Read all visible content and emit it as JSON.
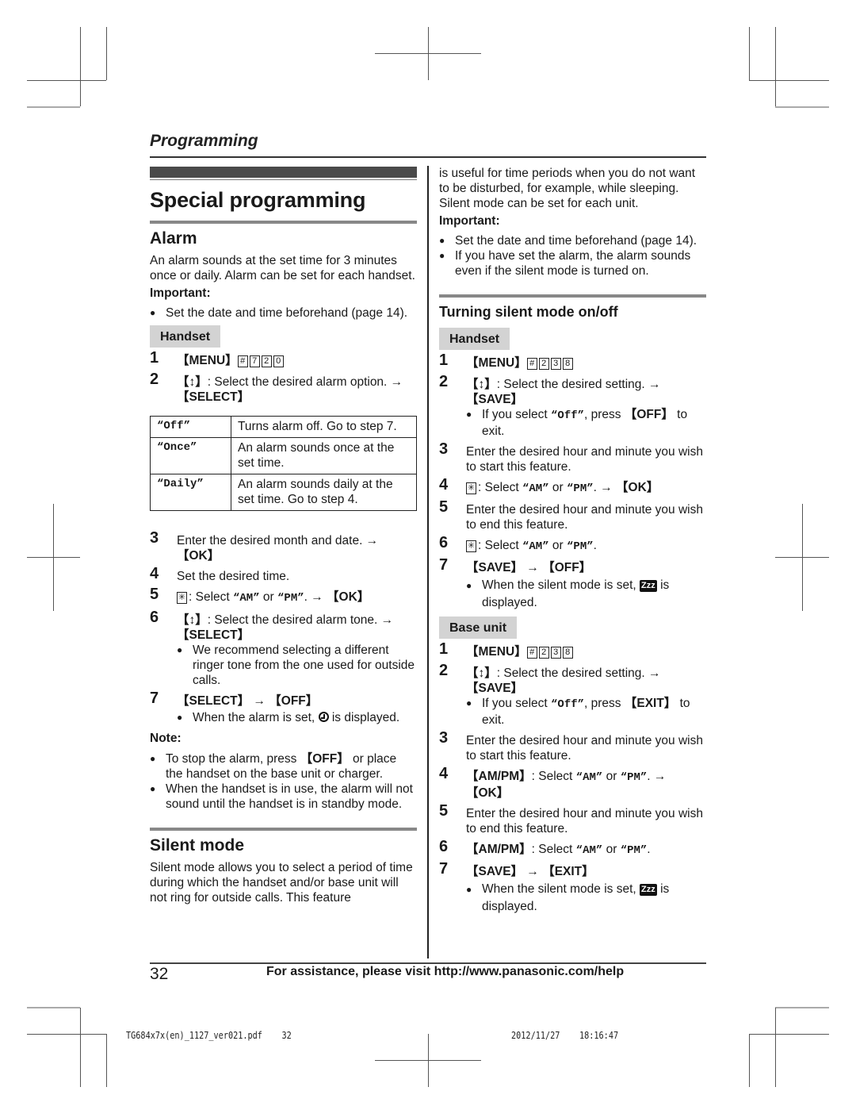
{
  "header": {
    "running_title": "Programming"
  },
  "left_column": {
    "page_title": "Special programming",
    "alarm": {
      "heading": "Alarm",
      "intro": "An alarm sounds at the set time for 3 minutes once or daily. Alarm can be set for each handset.",
      "important_label": "Important:",
      "important_items": [
        "Set the date and time beforehand (page 14)."
      ],
      "unit_tag": "Handset",
      "step1": {
        "num": "1",
        "key": "【MENU】",
        "codes": [
          "#",
          "7",
          "2",
          "0"
        ]
      },
      "step2": {
        "num": "2",
        "nav": "【↕】",
        "text": ": Select the desired alarm option. →",
        "key": "【SELECT】"
      },
      "options_table": [
        {
          "option": "“Off”",
          "desc": "Turns alarm off. Go to step 7."
        },
        {
          "option": "“Once”",
          "desc": "An alarm sounds once at the set time."
        },
        {
          "option": "“Daily”",
          "desc": "An alarm sounds daily at the set time. Go to step 4."
        }
      ],
      "step3": {
        "num": "3",
        "text": "Enter the desired month and date. →",
        "key": "【OK】"
      },
      "step4": {
        "num": "4",
        "text": "Set the desired time."
      },
      "step5": {
        "num": "5",
        "star": "✳",
        "text_a": ": Select ",
        "am": "“AM”",
        "or": " or ",
        "pm": "“PM”",
        "text_b": ". → ",
        "key": "【OK】"
      },
      "step6": {
        "num": "6",
        "nav": "【↕】",
        "text": ": Select the desired alarm tone. →",
        "key": "【SELECT】",
        "bullet": "We recommend selecting a different ringer tone from the one used for outside calls."
      },
      "step7": {
        "num": "7",
        "key_a": "【SELECT】",
        "arrow": " → ",
        "key_b": "【OFF】",
        "bullet_a": "When the alarm is set,",
        "bullet_b": "is displayed."
      },
      "note_label": "Note:",
      "notes": [
        {
          "a": "To stop the alarm, press ",
          "key": "【OFF】",
          "b": " or place the handset on the base unit or charger."
        },
        {
          "a": "When the handset is in use, the alarm will not sound until the handset is in standby mode.",
          "key": "",
          "b": ""
        }
      ]
    },
    "silent_mode": {
      "heading": "Silent mode",
      "intro": "Silent mode allows you to select a period of time during which the handset and/or base unit will not ring for outside calls. This feature"
    }
  },
  "right_column": {
    "intro_cont": "is useful for time periods when you do not want to be disturbed, for example, while sleeping. Silent mode can be set for each unit.",
    "important_label": "Important:",
    "important_items": [
      "Set the date and time beforehand (page 14).",
      "If you have set the alarm, the alarm sounds even if the silent mode is turned on."
    ],
    "subheading": "Turning silent mode on/off",
    "handset": {
      "tag": "Handset",
      "step1": {
        "num": "1",
        "key": "【MENU】",
        "codes": [
          "#",
          "2",
          "3",
          "8"
        ]
      },
      "step2": {
        "num": "2",
        "nav": "【↕】",
        "text": ": Select the desired setting. →",
        "key": "【SAVE】",
        "bullet_a": "If you select ",
        "off": "“Off”",
        "bullet_b": ", press ",
        "bullet_key": "【OFF】",
        "bullet_c": " to exit."
      },
      "step3": {
        "num": "3",
        "text": "Enter the desired hour and minute you wish to start this feature."
      },
      "step4": {
        "num": "4",
        "star": "✳",
        "text_a": ": Select ",
        "am": "“AM”",
        "or": " or ",
        "pm": "“PM”",
        "text_b": ". → ",
        "key": "【OK】"
      },
      "step5": {
        "num": "5",
        "text": "Enter the desired hour and minute you wish to end this feature."
      },
      "step6": {
        "num": "6",
        "star": "✳",
        "text_a": ": Select ",
        "am": "“AM”",
        "or": " or ",
        "pm": "“PM”",
        "text_b": "."
      },
      "step7": {
        "num": "7",
        "key_a": "【SAVE】",
        "arrow": " → ",
        "key_b": "【OFF】",
        "bullet_a": "When the silent mode is set,",
        "icon": "Zzz",
        "bullet_b": "is displayed."
      }
    },
    "base_unit": {
      "tag": "Base unit",
      "step1": {
        "num": "1",
        "key": "【MENU】",
        "codes": [
          "#",
          "2",
          "3",
          "8"
        ]
      },
      "step2": {
        "num": "2",
        "nav": "【↕】",
        "text": ": Select the desired setting. →",
        "key": "【SAVE】",
        "bullet_a": "If you select ",
        "off": "“Off”",
        "bullet_b": ", press ",
        "bullet_key": "【EXIT】",
        "bullet_c": " to exit."
      },
      "step3": {
        "num": "3",
        "text": "Enter the desired hour and minute you wish to start this feature."
      },
      "step4": {
        "num": "4",
        "key_a": "【AM/PM】",
        "text_a": ": Select ",
        "am": "“AM”",
        "or": " or ",
        "pm": "“PM”",
        "text_b": ". → ",
        "key": "【OK】"
      },
      "step5": {
        "num": "5",
        "text": "Enter the desired hour and minute you wish to end this feature."
      },
      "step6": {
        "num": "6",
        "key_a": "【AM/PM】",
        "text_a": ": Select ",
        "am": "“AM”",
        "or": " or ",
        "pm": "“PM”",
        "text_b": "."
      },
      "step7": {
        "num": "7",
        "key_a": "【SAVE】",
        "arrow": " → ",
        "key_b": "【EXIT】",
        "bullet_a": "When the silent mode is set,",
        "icon": "Zzz",
        "bullet_b": "is displayed."
      }
    }
  },
  "footer": {
    "page_number": "32",
    "assistance": "For assistance, please visit http://www.panasonic.com/help",
    "slug_file": "TG684x7x(en)_1127_ver021.pdf",
    "slug_page": "32",
    "slug_date": "2012/11/27",
    "slug_time": "18:16:47"
  }
}
